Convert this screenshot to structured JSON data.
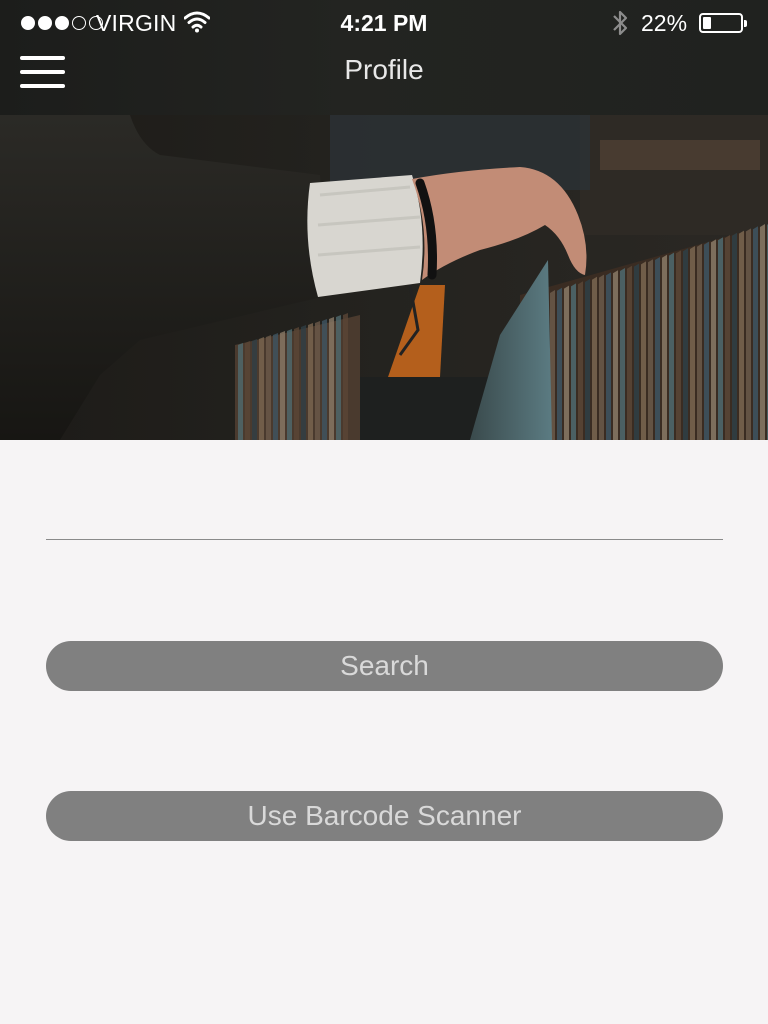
{
  "status_bar": {
    "signal_bars_filled": 3,
    "signal_bars_total": 5,
    "carrier": "VIRGIN",
    "time": "4:21 PM",
    "battery_percent": "22%",
    "battery_level": 0.22,
    "icons": [
      "signal-dots-icon",
      "wifi-icon",
      "bluetooth-icon",
      "battery-icon"
    ]
  },
  "nav": {
    "title": "Profile",
    "menu_icon": "hamburger-menu-icon"
  },
  "hero": {
    "description_icon": "record-crates-photo"
  },
  "form": {
    "search_value": "",
    "search_placeholder": "",
    "search_button": "Search",
    "barcode_button": "Use Barcode Scanner"
  },
  "colors": {
    "background": "#f6f4f5",
    "header": "#222320",
    "button": "#808080",
    "button_text": "#d9d9d9"
  }
}
